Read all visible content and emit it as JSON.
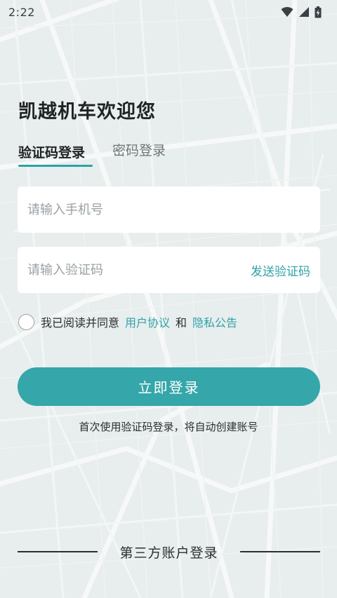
{
  "status_bar": {
    "time": "2:22",
    "icons": [
      "wifi-icon",
      "signal-icon",
      "battery-icon"
    ]
  },
  "header": {
    "welcome": "凯越机车欢迎您"
  },
  "tabs": [
    {
      "label": "验证码登录",
      "active": true
    },
    {
      "label": "密码登录",
      "active": false
    }
  ],
  "form": {
    "phone_placeholder": "请输入手机号",
    "code_placeholder": "请输入验证码",
    "send_code_label": "发送验证码"
  },
  "agreement": {
    "prefix": "我已阅读并同意",
    "user_agreement": "用户协议",
    "and": "和",
    "privacy_notice": "隐私公告",
    "checked": false
  },
  "login_button": "立即登录",
  "hint": "首次使用验证码登录，将自动创建账号",
  "third_party": "第三方账户登录",
  "colors": {
    "accent": "#35a6a9",
    "link": "#2fa2a6",
    "text": "#1f2326",
    "background": "#e9eeee"
  }
}
